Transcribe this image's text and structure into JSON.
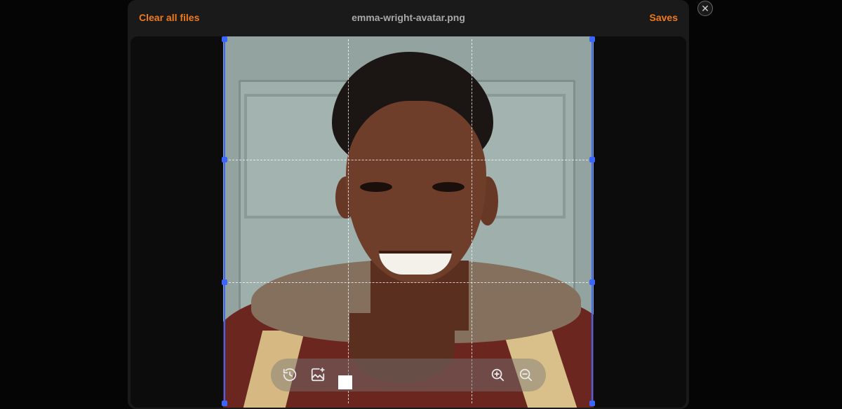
{
  "header": {
    "clear_label": "Clear all files",
    "file_name": "emma-wright-avatar.png",
    "save_label": "Saves"
  },
  "close": {
    "glyph": "✕",
    "icon": "close-icon"
  },
  "toolbar": {
    "buttons": [
      {
        "icon": "history-icon",
        "action": "reset"
      },
      {
        "icon": "image-sparkle-icon",
        "action": "enhance"
      },
      {
        "icon": "zoom-in-icon",
        "action": "zoom-in"
      },
      {
        "icon": "zoom-out-icon",
        "action": "zoom-out"
      }
    ],
    "swatch_color": "#ffffff"
  },
  "colors": {
    "accent": "#f07a1a",
    "crop_frame": "#3a66ff",
    "background": "#050505",
    "modal": "#1a1a1a"
  }
}
